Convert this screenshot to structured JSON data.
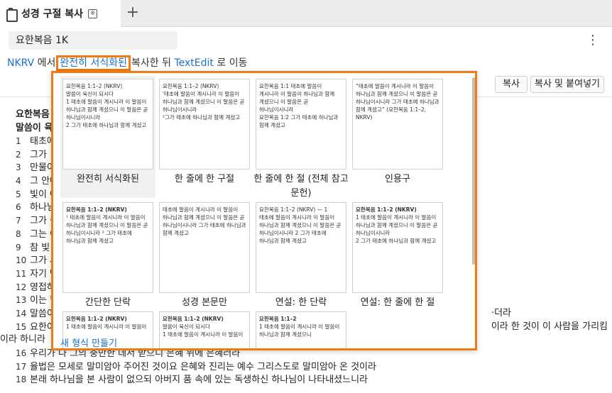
{
  "tab": {
    "title": "성경 구절 복사",
    "badge_icon": "※",
    "new_tab": "+"
  },
  "search": {
    "value": "요한복음 1K"
  },
  "menu": {
    "more": "⋮"
  },
  "instruction": {
    "source": "NKRV",
    "in": "에서",
    "format": "완전히 서식화된",
    "copy_then": "복사한 뒤",
    "target": "TextEdit",
    "move": "로 이동"
  },
  "buttons": {
    "copy": "복사",
    "copy_paste": "복사 및 붙여넣기"
  },
  "passage": {
    "head1": "요한복음",
    "head2": "말씀이 육",
    "verses": [
      {
        "n": "1",
        "t": "태초에"
      },
      {
        "n": "2",
        "t": "그가"
      },
      {
        "n": "3",
        "t": "만물이"
      },
      {
        "n": "4",
        "t": "그 안에"
      },
      {
        "n": "5",
        "t": "빛이 어"
      },
      {
        "n": "6",
        "t": "하나님"
      },
      {
        "n": "7",
        "t": "그가 증"
      },
      {
        "n": "8",
        "t": "그는 이"
      },
      {
        "n": "9",
        "t": "참 빛"
      },
      {
        "n": "10",
        "t": "그가 세"
      },
      {
        "n": "11",
        "t": "자기 땅"
      },
      {
        "n": "12",
        "t": "영접하"
      },
      {
        "n": "13",
        "t": "이는 할"
      },
      {
        "n": "14",
        "t": "말씀이",
        "tail": "·더라"
      },
      {
        "n": "15",
        "t": "요한이",
        "tail": "이라 한 것이 이 사람을 가리킴"
      },
      {
        "n": "",
        "t": "이라 하니라"
      },
      {
        "n": "16",
        "t": "우리가 다 그의 충만한 데서 받으니 은혜 위에 은혜러라"
      },
      {
        "n": "17",
        "t": "율법은 모세로 말미암아 주어진 것이요 은혜와 진리는 예수 그리스도로 말미암아 온 것이라"
      },
      {
        "n": "18",
        "t": "본래 하나님을 본 사람이 없으되 아버지 품 속에 있는 독생하신 하나님이 나타내셨느니라"
      }
    ]
  },
  "formats": [
    {
      "label": "완전히 서식화된",
      "preview": [
        "요한복음 1:1–2 (NKRV)",
        "말씀이 육신이 되시다",
        "1 태초에 말씀이 계시니라 이 말씀이 하나님과 함께 계셨으니 이 말씀은 곧 하나님이시니라",
        "2 그가 태초에 하나님과 함께 계셨고"
      ]
    },
    {
      "label": "한 줄에 한 구절",
      "preview": [
        "요한복음 1:1–2 (NKRV)",
        "'태초에 말씀이 계시니라 이 말씀이 하나님과 함께 계셨으니 이 말씀은 곧 하나님이시니라",
        "²그가 태초에 하나님과 함께 계셨고"
      ]
    },
    {
      "label": "한 줄에 한 절 (전체 참고 문헌)",
      "preview": [
        "요한복음 1:1 태초에 말씀이 계시니라 이 말씀이 하나님과 함께 계셨으니 이 말씀은 곧 하나님이시니라",
        "요한복음 1:2 그가 태초에 하나님과 함께 계셨고"
      ]
    },
    {
      "label": "인용구",
      "preview": [
        "“태초에 말씀이 계시니라 이 말씀이 하나님과 함께 계셨으니 이 말씀은 곧 하나님이시니라 그가 태초에 하나님과 함께 계셨고” (요한복음 1:1–2, NKRV)"
      ]
    },
    {
      "label": "간단한 단락",
      "preview": [
        "요한복음 1:1–2 (NKRV)",
        "¹ 태초에 말씀이 계시니라 이 말씀이 하나님과 함께 계셨으니 이 말씀은 곧 하나님이시니라 ² 그가 태초에 하나님과 함께 계셨고"
      ]
    },
    {
      "label": "성경 본문만",
      "preview": [
        "태초에 말씀이 계시니라 이 말씀이 하나님과 함께 계셨으니 이 말씀은 곧 하나님이시니라 그가 태초에 하나님과 함께 계셨고"
      ]
    },
    {
      "label": "연설: 한 단락",
      "preview": [
        "요한복음 1:1–2 (NKRV) — 1 태초에 말씀이 계시니라 이 말씀이 하나님과 함께 계셨으니 이 말씀은 곧 하나님이시니라 2 그가 태초에 하나님과 함께 계셨고"
      ]
    },
    {
      "label": "연설: 한 줄에 한 절",
      "preview": [
        "요한복음 1:1–2 (NKRV)",
        "1 태초에 말씀이 계시니라 이 말씀이 하나님과 함께 계셨으니 이 말씀은 곧 하나님이시니라",
        "2 그가 태초에 하나님과 함께 계셨고"
      ]
    },
    {
      "label": "",
      "preview": [
        "요한복음 1:1–2 (NKRV)",
        "1 태초에 말씀이 계시니라 이 말씀이"
      ]
    },
    {
      "label": "",
      "preview": [
        "요한복음 1:1–2 (NKRV)",
        "말씀이 육신이 되시다",
        "1 태초에 말씀이 계시니라 이 말씀이"
      ]
    },
    {
      "label": "",
      "preview": [
        "요한복음 1:1–2",
        "1 태초에 말씀이 계시니라 이 말씀이 하나님과 함께 계셨으니"
      ]
    }
  ],
  "new_format": "새 형식 만들기"
}
